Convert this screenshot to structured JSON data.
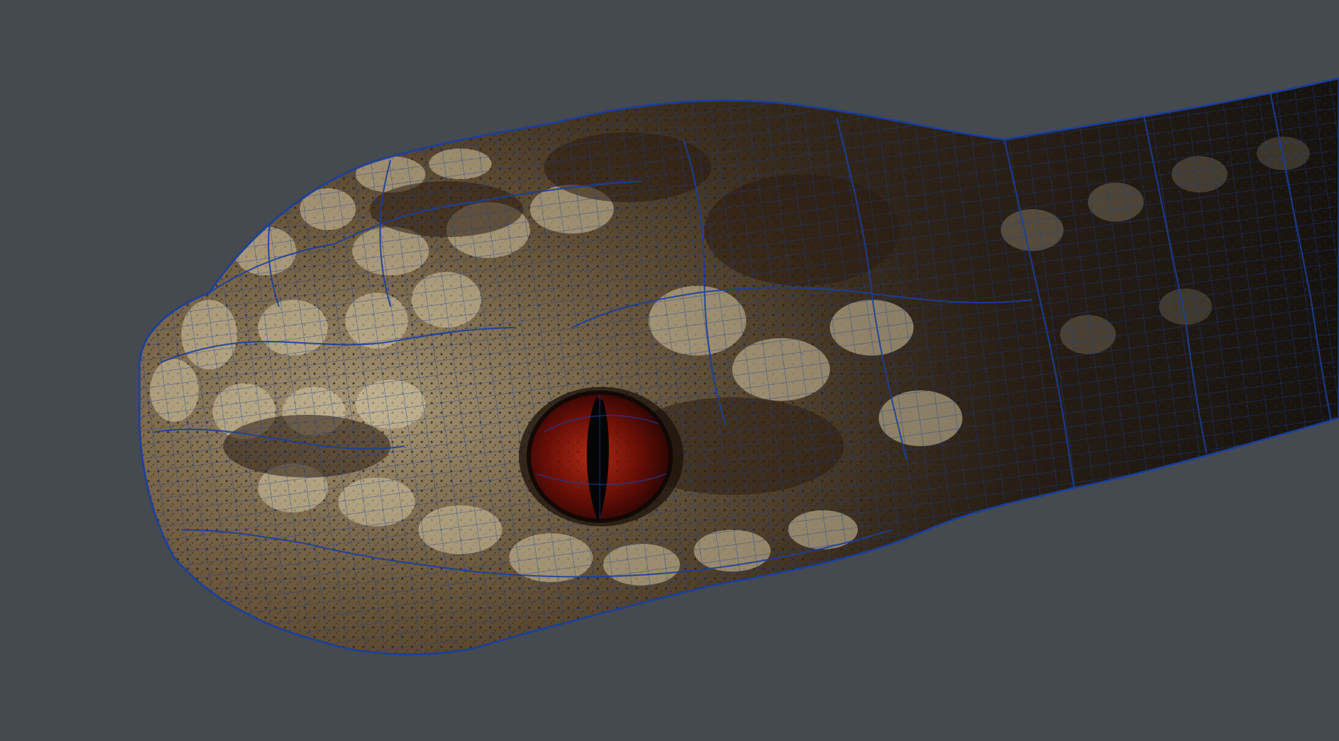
{
  "viewport": {
    "background_color": "#454a4f",
    "subject": "snake-head-wireframe-render"
  },
  "colors": {
    "wireframe": "#1a3f9e",
    "scale_light": "#d9cdb0",
    "scale_mid": "#8a7450",
    "scale_dark": "#2a1d12",
    "eye_red": "#7a0f08",
    "pupil": "#050505"
  },
  "icons": {
    "mesh": "wireframe-mesh-icon",
    "eye": "eye-icon"
  }
}
